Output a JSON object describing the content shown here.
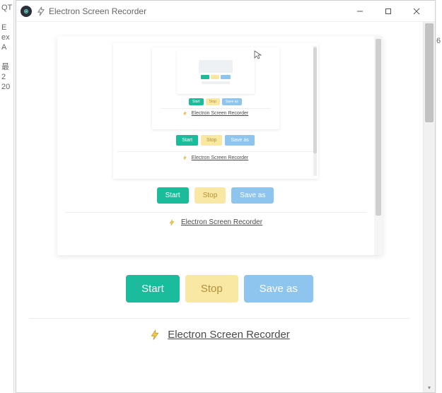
{
  "background_hints": {
    "left_fragments": [
      "QT",
      "",
      "",
      "",
      "E",
      "ex",
      "A",
      "",
      "最",
      "2",
      "20"
    ],
    "right_fragment": "6"
  },
  "window": {
    "title": "Electron Screen Recorder"
  },
  "buttons": {
    "start": "Start",
    "stop": "Stop",
    "save_as": "Save as"
  },
  "footer": {
    "link_text": "Electron Screen Recorder"
  }
}
